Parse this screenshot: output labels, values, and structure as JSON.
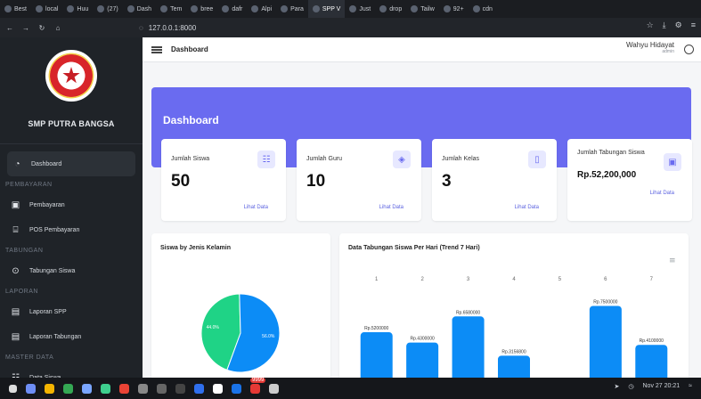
{
  "browser": {
    "tabs": [
      {
        "label": "Best"
      },
      {
        "label": "local"
      },
      {
        "label": "Huu"
      },
      {
        "label": "(27)"
      },
      {
        "label": "Dash"
      },
      {
        "label": "Tem"
      },
      {
        "label": "bree"
      },
      {
        "label": "dafr"
      },
      {
        "label": "Alpi"
      },
      {
        "label": "Para"
      },
      {
        "label": "SPP V"
      },
      {
        "label": "Just"
      },
      {
        "label": "drop"
      },
      {
        "label": "Tailw"
      },
      {
        "label": "92+"
      },
      {
        "label": "cdn"
      }
    ],
    "active_tab_index": 10,
    "url": "127.0.0.1:8000"
  },
  "sidebar": {
    "school_name": "SMP PUTRA BANGSA",
    "items": [
      {
        "type": "item",
        "label": "Dashboard",
        "icon": "pie-chart-icon",
        "active": true
      },
      {
        "type": "section",
        "label": "PEMBAYARAN"
      },
      {
        "type": "item",
        "label": "Pembayaran",
        "icon": "money-icon"
      },
      {
        "type": "item",
        "label": "POS Pembayaran",
        "icon": "register-icon"
      },
      {
        "type": "section",
        "label": "TABUNGAN"
      },
      {
        "type": "item",
        "label": "Tabungan Siswa",
        "icon": "user-icon"
      },
      {
        "type": "section",
        "label": "LAPORAN"
      },
      {
        "type": "item",
        "label": "Laporan SPP",
        "icon": "report-icon"
      },
      {
        "type": "item",
        "label": "Laporan Tabungan",
        "icon": "report-icon"
      },
      {
        "type": "section",
        "label": "MASTER DATA"
      },
      {
        "type": "item",
        "label": "Data Siswa",
        "icon": "users-icon"
      }
    ]
  },
  "topbar": {
    "page_title": "Dashboard",
    "user_name": "Wahyu Hidayat",
    "user_role": "admin"
  },
  "hero": {
    "title": "Dashboard"
  },
  "stats": [
    {
      "label": "Jumlah Siswa",
      "value": "50",
      "link": "Lihat Data",
      "icon": "users-icon"
    },
    {
      "label": "Jumlah Guru",
      "value": "10",
      "link": "Lihat Data",
      "icon": "graduation-cap-icon"
    },
    {
      "label": "Jumlah Kelas",
      "value": "3",
      "link": "Lihat Data",
      "icon": "door-icon"
    },
    {
      "label": "Jumlah Tabungan Siswa",
      "value": "Rp.52,200,000",
      "link": "Lihat Data",
      "icon": "wallet-icon"
    }
  ],
  "pie_panel": {
    "title": "Siswa by Jenis Kelamin",
    "slices": [
      {
        "label": "44.0%",
        "value": 44.0,
        "color": "#1fd386"
      },
      {
        "label": "56.0%",
        "value": 56.0,
        "color": "#0c8cf6"
      }
    ]
  },
  "bar_panel": {
    "title": "Data Tabungan Siswa Per Hari (Trend 7 Hari)"
  },
  "chart_data": {
    "type": "bar",
    "categories": [
      "1",
      "2",
      "3",
      "4",
      "5",
      "6",
      "7"
    ],
    "values": [
      5200000,
      4300000,
      6580000,
      3156800,
      0,
      7500000,
      4100000
    ],
    "value_labels": [
      "Rp.5200000",
      "Rp.4300000",
      "Rp.6580000",
      "Rp.3156800",
      "",
      "Rp.7500000",
      "Rp.4100000"
    ],
    "bar_color": "#0c8cf6"
  },
  "taskbar": {
    "datetime": "Nov 27 20:21",
    "badge": "9999"
  }
}
